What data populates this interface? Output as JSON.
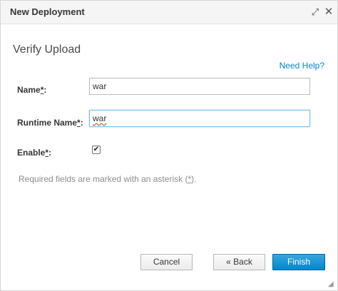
{
  "dialog": {
    "title": "New Deployment",
    "maximize_icon": "maximize-icon",
    "close_icon": "close-icon",
    "maximize_glyph": "⤢",
    "close_glyph": "✕"
  },
  "form": {
    "section_title": "Verify Upload",
    "help_link": "Need Help?",
    "name_label": "Name",
    "runtime_label": "Runtime Name",
    "enable_label": "Enable",
    "asterisk": "*",
    "colon": ":",
    "name_value": "war",
    "runtime_value": "war",
    "enable_checked": true,
    "hint_prefix": "Required fields are marked with an asterisk (",
    "hint_suffix": ")."
  },
  "buttons": {
    "cancel": "Cancel",
    "back": "« Back",
    "finish": "Finish"
  },
  "colors": {
    "primary": "#0088ce",
    "link": "#0088ce",
    "focus_border": "#7dc3e8"
  }
}
